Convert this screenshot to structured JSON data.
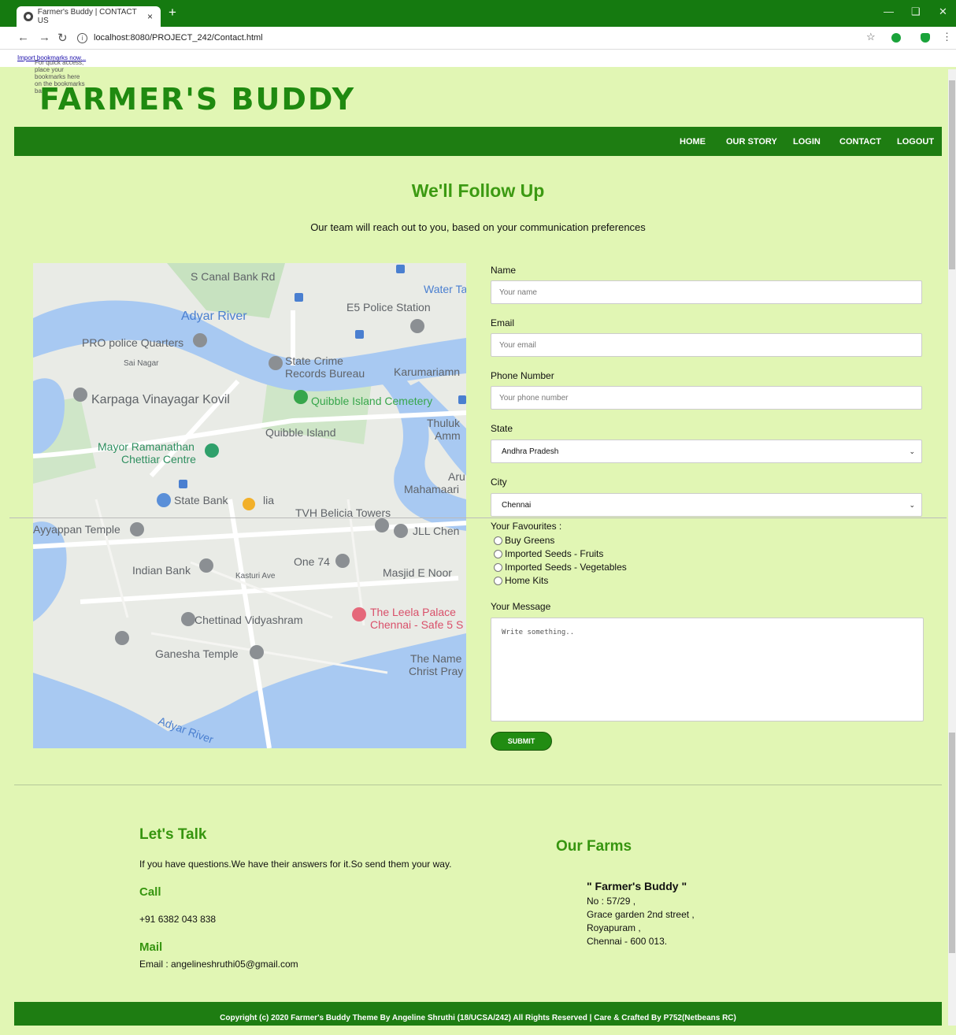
{
  "browser": {
    "tab_title": "Farmer's Buddy | CONTACT US",
    "tab_close": "×",
    "new_tab": "+",
    "url": "localhost:8080/PROJECT_242/Contact.html",
    "bookmarks_text": "For quick access, place your bookmarks here on the bookmarks bar.",
    "bookmarks_link": "Import bookmarks now..."
  },
  "site": {
    "logo": "FARMER'S BUDDY",
    "nav": [
      "HOME",
      "OUR STORY",
      "LOGIN",
      "CONTACT",
      "LOGOUT"
    ]
  },
  "contact": {
    "heading": "We'll Follow Up",
    "subheading": "Our team will reach out to you, based on your communication preferences"
  },
  "map": {
    "labels": [
      "S Canal Bank Rd",
      "Water Ta",
      "Adyar River",
      "E5 Police Station",
      "PRO police Quarters",
      "Sai Nagar",
      "State Crime",
      "Records Bureau",
      "Karumariamn",
      "Karpaga Vinayagar Kovil",
      "Quibble Island Cemetery",
      "Quibble Island",
      "Thuluk",
      "Amm",
      "Mayor Ramanathan",
      "Chettiar Centre",
      "Aru",
      "Mahamaari",
      "State Bank",
      "lia",
      "TVH Belicia Towers",
      "Ayyappan Temple",
      "JLL Chen",
      "One 74",
      "Indian Bank",
      "Kasturi Ave",
      "Masjid E Noor",
      "Chettinad Vidyashram",
      "The Leela Palace",
      "Chennai - Safe 5 S",
      "Ganesha Temple",
      "The Name",
      "Christ Pray",
      "Adyar River"
    ]
  },
  "form": {
    "name_label": "Name",
    "name_placeholder": "Your name",
    "email_label": "Email",
    "email_placeholder": "Your email",
    "phone_label": "Phone Number",
    "phone_placeholder": "Your phone number",
    "state_label": "State",
    "state_value": "Andhra Pradesh",
    "city_label": "City",
    "city_value": "Chennai",
    "favourites_label": "Your Favourites :",
    "favourites": [
      "Buy Greens",
      "Imported Seeds - Fruits",
      "Imported Seeds - Vegetables",
      "Home Kits"
    ],
    "message_label": "Your Message",
    "message_placeholder": "Write something..",
    "submit_label": "SUBMIT"
  },
  "footer": {
    "talk_heading": "Let's Talk",
    "talk_text": "If you have questions.We have their answers for it.So send them your way.",
    "call_heading": "Call",
    "phone": "+91 6382 043 838",
    "mail_heading": "Mail",
    "email": "Email : angelineshruthi05@gmail.com",
    "farms_heading": "Our Farms",
    "farm_name": "\" Farmer's Buddy \"",
    "address": [
      "No : 57/29 ,",
      "Grace garden 2nd street ,",
      "Royapuram ,",
      "Chennai - 600 013."
    ],
    "copyright": "Copyright (c) 2020 Farmer's Buddy Theme By Angeline Shruthi (18/UCSA/242) All Rights Reserved | Care & Crafted By P752(Netbeans RC)"
  },
  "colors": {
    "page_bg": "#e1f6b4",
    "nav_green": "#1e7d12",
    "heading_green": "#3c9a12",
    "water": "#a8c9f2"
  }
}
